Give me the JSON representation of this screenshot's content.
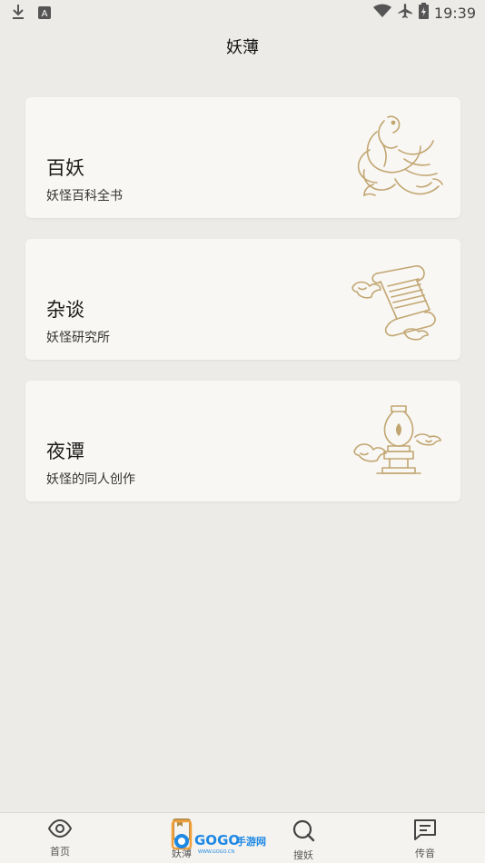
{
  "status_bar": {
    "time": "19:39",
    "icons": [
      "download-icon",
      "a-icon",
      "wifi-icon",
      "airplane-icon",
      "battery-icon"
    ]
  },
  "header": {
    "title": "妖薄"
  },
  "cards": [
    {
      "title": "百妖",
      "subtitle": "妖怪百科全书",
      "art": "phoenix-icon"
    },
    {
      "title": "杂谈",
      "subtitle": "妖怪研究所",
      "art": "scroll-icon"
    },
    {
      "title": "夜谭",
      "subtitle": "妖怪的同人创作",
      "art": "lamp-icon"
    }
  ],
  "nav": [
    {
      "label": "首页",
      "icon": "eye-icon"
    },
    {
      "label": "妖薄",
      "icon": "book-icon"
    },
    {
      "label": "搜妖",
      "icon": "search-icon"
    },
    {
      "label": "传音",
      "icon": "message-icon"
    }
  ],
  "watermark": {
    "text": "GOGO手游网",
    "sub": "WWW.GOGO.CN"
  },
  "colors": {
    "background": "#ecebe7",
    "card": "#f8f7f3",
    "accent": "#c9ad7a",
    "watermark_blue": "#1e88e5"
  }
}
